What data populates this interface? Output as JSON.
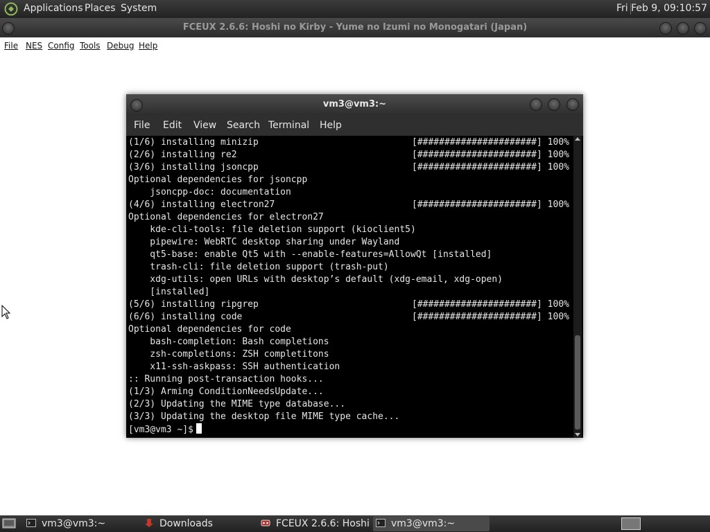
{
  "top_panel": {
    "menus": [
      "Applications",
      "Places",
      "System"
    ],
    "clock": "Fri Feb  9, 09:10:57"
  },
  "app_window": {
    "title": "FCEUX 2.6.6: Hoshi no Kirby - Yume no Izumi no Monogatari (Japan)",
    "menu": [
      "File",
      "NES",
      "Config",
      "Tools",
      "Debug",
      "Help"
    ]
  },
  "terminal": {
    "title": "vm3@vm3:~",
    "menu": [
      "File",
      "Edit",
      "View",
      "Search",
      "Terminal",
      "Help"
    ],
    "progress_bar_text": "[######################] 100%",
    "lines": [
      {
        "text": "(1/6) installing minizip",
        "progress": true
      },
      {
        "text": "(2/6) installing re2",
        "progress": true
      },
      {
        "text": "(3/6) installing jsoncpp",
        "progress": true
      },
      {
        "text": "Optional dependencies for jsoncpp",
        "progress": false
      },
      {
        "text": "    jsoncpp-doc: documentation",
        "progress": false
      },
      {
        "text": "(4/6) installing electron27",
        "progress": true
      },
      {
        "text": "Optional dependencies for electron27",
        "progress": false
      },
      {
        "text": "    kde-cli-tools: file deletion support (kioclient5)",
        "progress": false
      },
      {
        "text": "    pipewire: WebRTC desktop sharing under Wayland",
        "progress": false
      },
      {
        "text": "    qt5-base: enable Qt5 with --enable-features=AllowQt [installed]",
        "progress": false
      },
      {
        "text": "    trash-cli: file deletion support (trash-put)",
        "progress": false
      },
      {
        "text": "    xdg-utils: open URLs with desktop’s default (xdg-email, xdg-open)",
        "progress": false
      },
      {
        "text": "    [installed]",
        "progress": false
      },
      {
        "text": "(5/6) installing ripgrep",
        "progress": true
      },
      {
        "text": "(6/6) installing code",
        "progress": true
      },
      {
        "text": "Optional dependencies for code",
        "progress": false
      },
      {
        "text": "    bash-completion: Bash completions",
        "progress": false
      },
      {
        "text": "    zsh-completions: ZSH completitons",
        "progress": false
      },
      {
        "text": "    x11-ssh-askpass: SSH authentication",
        "progress": false
      },
      {
        "text": ":: Running post-transaction hooks...",
        "progress": false
      },
      {
        "text": "(1/3) Arming ConditionNeedsUpdate...",
        "progress": false
      },
      {
        "text": "(2/3) Updating the MIME type database...",
        "progress": false
      },
      {
        "text": "(3/3) Updating the desktop file MIME type cache...",
        "progress": false
      }
    ],
    "prompt": "[vm3@vm3 ~]$"
  },
  "taskbar": {
    "tasks": [
      {
        "label": "vm3@vm3:~",
        "icon": "terminal-icon",
        "active": false
      },
      {
        "label": "Downloads",
        "icon": "folder-icon",
        "active": false
      },
      {
        "label": "FCEUX 2.6.6: Hoshi ...",
        "icon": "fceux-icon",
        "active": false
      },
      {
        "label": "vm3@vm3:~",
        "icon": "terminal-icon",
        "active": true
      }
    ]
  }
}
